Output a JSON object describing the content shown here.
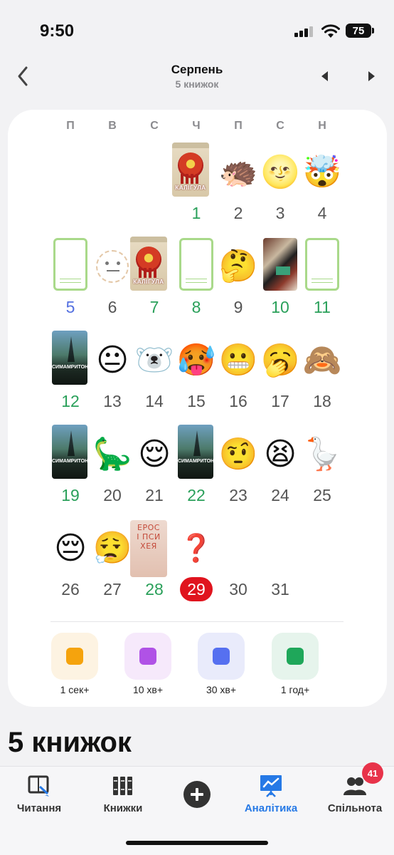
{
  "status_bar": {
    "time": "9:50",
    "battery": "75"
  },
  "header": {
    "title": "Серпень",
    "subtitle": "5 книжок"
  },
  "calendar": {
    "weekdays": [
      "П",
      "В",
      "С",
      "Ч",
      "П",
      "С",
      "Н"
    ],
    "days": [
      {
        "n": "1",
        "kind": "cover",
        "cover": "caligula",
        "status": "read",
        "cover_text": "КАЛІГУЛА"
      },
      {
        "n": "2",
        "kind": "emoji",
        "emoji": "🦔",
        "status": "plain"
      },
      {
        "n": "3",
        "kind": "emoji",
        "emoji": "🌝",
        "status": "plain"
      },
      {
        "n": "4",
        "kind": "emoji",
        "emoji": "🤯",
        "status": "plain"
      },
      {
        "n": "5",
        "kind": "cover",
        "cover": "empty",
        "status": "blue"
      },
      {
        "n": "6",
        "kind": "mask",
        "status": "plain"
      },
      {
        "n": "7",
        "kind": "cover",
        "cover": "caligula",
        "status": "read",
        "cover_text": "КАЛІГУЛА"
      },
      {
        "n": "8",
        "kind": "cover",
        "cover": "empty",
        "status": "read"
      },
      {
        "n": "9",
        "kind": "emoji",
        "emoji": "🤔",
        "status": "plain"
      },
      {
        "n": "10",
        "kind": "cover",
        "cover": "art",
        "status": "read"
      },
      {
        "n": "11",
        "kind": "cover",
        "cover": "empty",
        "status": "read"
      },
      {
        "n": "12",
        "kind": "cover",
        "cover": "sym",
        "status": "read",
        "cover_text": "СИМАМРИТОН"
      },
      {
        "n": "13",
        "kind": "emoji",
        "emoji": "😐",
        "status": "plain"
      },
      {
        "n": "14",
        "kind": "emoji",
        "emoji": "🐻‍❄️",
        "status": "plain"
      },
      {
        "n": "15",
        "kind": "emoji",
        "emoji": "🥵",
        "status": "plain"
      },
      {
        "n": "16",
        "kind": "emoji",
        "emoji": "😬",
        "status": "plain"
      },
      {
        "n": "17",
        "kind": "emoji",
        "emoji": "🥱",
        "status": "plain"
      },
      {
        "n": "18",
        "kind": "emoji",
        "emoji": "🙈",
        "status": "plain"
      },
      {
        "n": "19",
        "kind": "cover",
        "cover": "sym",
        "status": "read",
        "cover_text": "СИМАМРИТОН"
      },
      {
        "n": "20",
        "kind": "emoji",
        "emoji": "🦕",
        "status": "plain"
      },
      {
        "n": "21",
        "kind": "emoji",
        "emoji": "😌",
        "status": "plain"
      },
      {
        "n": "22",
        "kind": "cover",
        "cover": "sym",
        "status": "read",
        "cover_text": "СИМАМРИТОН"
      },
      {
        "n": "23",
        "kind": "emoji",
        "emoji": "🤨",
        "status": "plain"
      },
      {
        "n": "24",
        "kind": "emoji",
        "emoji": "😫",
        "status": "plain"
      },
      {
        "n": "25",
        "kind": "emoji",
        "emoji": "🪿",
        "status": "plain"
      },
      {
        "n": "26",
        "kind": "emoji",
        "emoji": "😔",
        "status": "plain"
      },
      {
        "n": "27",
        "kind": "emoji",
        "emoji": "😮‍💨",
        "status": "plain"
      },
      {
        "n": "28",
        "kind": "cover",
        "cover": "eros",
        "status": "read",
        "cover_text": [
          "ЕРОС",
          "І ПСИ",
          "ХЕЯ"
        ]
      },
      {
        "n": "29",
        "kind": "question",
        "emoji": "❓",
        "status": "today"
      },
      {
        "n": "30",
        "kind": "none",
        "status": "plain"
      },
      {
        "n": "31",
        "kind": "none",
        "status": "plain"
      }
    ],
    "start_weekday_index": 3
  },
  "legend": [
    {
      "label": "1 сек+",
      "color": "#f5a30d",
      "bg": "#fdf3e2"
    },
    {
      "label": "10 хв+",
      "color": "#b052e6",
      "bg": "#f6e9fb"
    },
    {
      "label": "30 хв+",
      "color": "#5670f0",
      "bg": "#e9ebfb"
    },
    {
      "label": "1 год+",
      "color": "#1fa75a",
      "bg": "#e6f4ec"
    }
  ],
  "section_title": "5 книжок",
  "tabs": [
    {
      "label": "Читання",
      "icon": "reading-icon"
    },
    {
      "label": "Книжки",
      "icon": "books-icon"
    },
    {
      "label": "Аналітика",
      "icon": "analytics-icon",
      "active": true
    },
    {
      "label": "Спільнота",
      "icon": "community-icon",
      "badge": "41"
    }
  ],
  "colors": {
    "read": "#2aa05a",
    "today": "#e0141e",
    "accent": "#2679e6"
  }
}
